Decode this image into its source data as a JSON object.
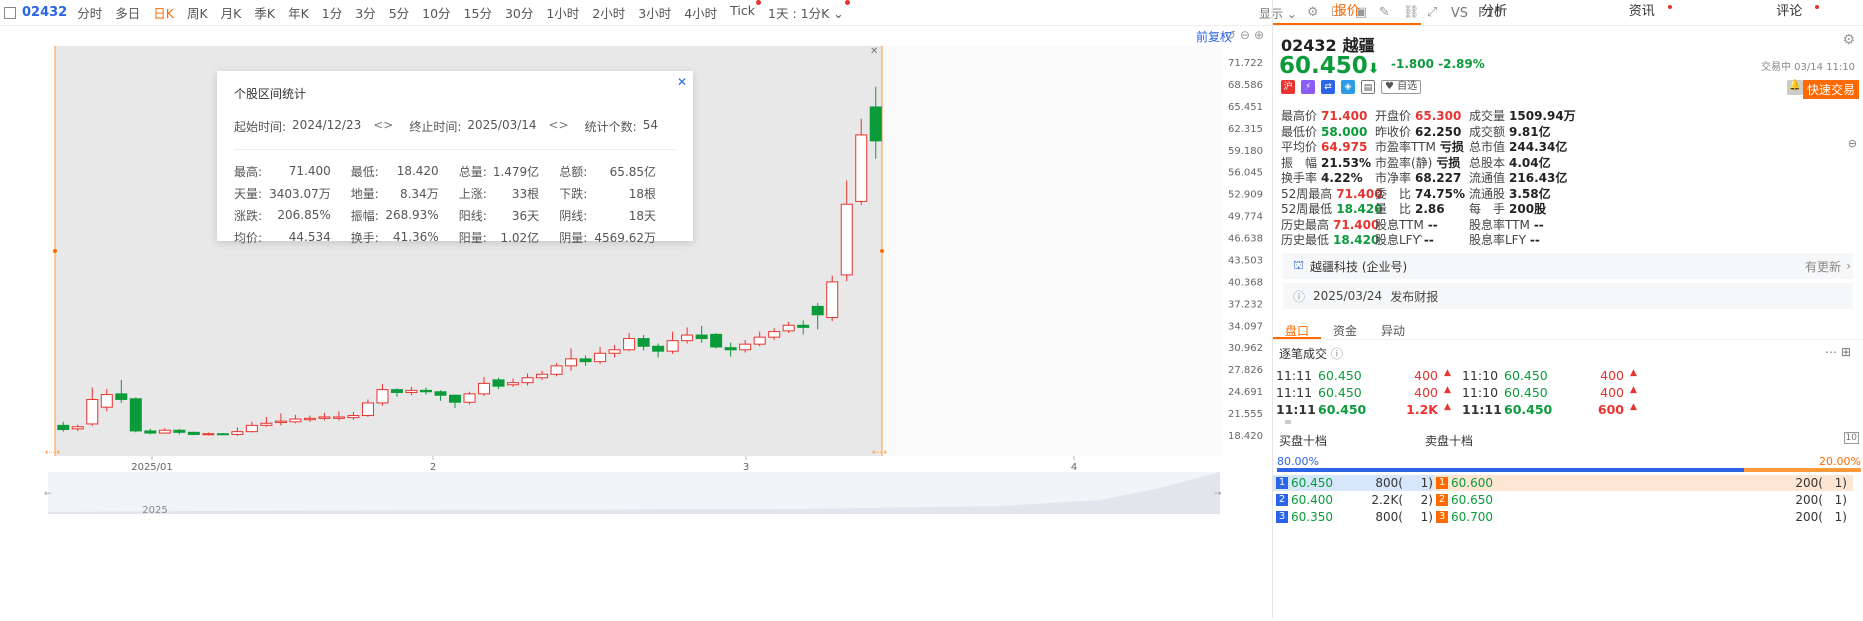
{
  "toolbar": {
    "code": "02432",
    "periods": [
      "分时",
      "多日",
      "日K",
      "周K",
      "月K",
      "季K",
      "年K",
      "1分",
      "3分",
      "5分",
      "10分",
      "15分",
      "30分",
      "1小时",
      "2小时",
      "3小时",
      "4小时",
      "Tick",
      "1天 : 1分K"
    ],
    "active": "日K",
    "display_label": "显示",
    "vs_label": "VS",
    "f10_label": "F10"
  },
  "chart": {
    "adjust_label": "前复权",
    "y_ticks": [
      "71.722",
      "68.586",
      "65.451",
      "62.315",
      "59.180",
      "56.045",
      "52.909",
      "49.774",
      "46.638",
      "43.503",
      "40.368",
      "37.232",
      "34.097",
      "30.962",
      "27.826",
      "24.691",
      "21.555",
      "18.420"
    ],
    "x_labels": [
      "2025/01",
      "2",
      "3",
      "4"
    ],
    "nav_label": "2025"
  },
  "chart_data": {
    "type": "candlestick",
    "x": "trading days 2024/12/23 – 2025/03/14",
    "ylim": [
      18.42,
      71.722
    ],
    "candles": [
      [
        19.8,
        19.2,
        20.3,
        18.9
      ],
      [
        19.3,
        19.6,
        19.9,
        19.0
      ],
      [
        20.0,
        23.5,
        25.2,
        19.7
      ],
      [
        22.4,
        24.2,
        25.0,
        21.8
      ],
      [
        24.3,
        23.5,
        26.3,
        23.0
      ],
      [
        23.6,
        19.0,
        23.8,
        18.8
      ],
      [
        19.0,
        18.7,
        19.3,
        18.5
      ],
      [
        18.7,
        19.1,
        19.4,
        18.6
      ],
      [
        19.1,
        18.8,
        19.3,
        18.5
      ],
      [
        18.8,
        18.5,
        18.9,
        18.4
      ],
      [
        18.5,
        18.6,
        18.8,
        18.4
      ],
      [
        18.6,
        18.5,
        18.7,
        18.4
      ],
      [
        18.5,
        18.9,
        19.5,
        18.3
      ],
      [
        18.9,
        19.8,
        20.3,
        18.8
      ],
      [
        19.8,
        20.1,
        21.0,
        19.6
      ],
      [
        20.2,
        20.4,
        21.5,
        19.8
      ],
      [
        20.3,
        20.7,
        21.3,
        20.1
      ],
      [
        20.6,
        20.8,
        21.2,
        20.3
      ],
      [
        20.8,
        21.0,
        21.6,
        20.5
      ],
      [
        20.8,
        21.0,
        21.8,
        20.5
      ],
      [
        20.9,
        21.2,
        21.7,
        20.6
      ],
      [
        21.2,
        23.0,
        23.5,
        21.0
      ],
      [
        23.0,
        24.9,
        25.7,
        22.6
      ],
      [
        24.9,
        24.5,
        25.1,
        23.9
      ],
      [
        24.5,
        24.8,
        25.3,
        24.1
      ],
      [
        24.8,
        24.6,
        25.2,
        24.2
      ],
      [
        24.6,
        24.1,
        24.8,
        23.3
      ],
      [
        24.1,
        23.1,
        24.2,
        22.3
      ],
      [
        23.1,
        24.3,
        24.6,
        22.8
      ],
      [
        24.3,
        25.8,
        26.7,
        24.0
      ],
      [
        26.3,
        25.4,
        26.6,
        25.0
      ],
      [
        25.6,
        25.9,
        26.5,
        25.3
      ],
      [
        25.9,
        26.6,
        27.2,
        25.5
      ],
      [
        26.6,
        27.1,
        27.6,
        26.3
      ],
      [
        27.1,
        28.3,
        28.7,
        26.8
      ],
      [
        28.3,
        29.3,
        30.8,
        27.6
      ],
      [
        29.3,
        28.9,
        29.8,
        28.3
      ],
      [
        28.9,
        30.1,
        31.0,
        28.6
      ],
      [
        30.1,
        30.6,
        31.3,
        29.5
      ],
      [
        30.6,
        32.2,
        33.0,
        30.4
      ],
      [
        32.2,
        31.1,
        32.7,
        30.5
      ],
      [
        31.1,
        30.4,
        31.5,
        29.5
      ],
      [
        30.4,
        31.9,
        33.2,
        30.0
      ],
      [
        31.9,
        32.7,
        33.8,
        31.5
      ],
      [
        32.7,
        32.2,
        34.0,
        31.6
      ],
      [
        32.8,
        31.0,
        33.0,
        30.8
      ],
      [
        30.9,
        30.6,
        31.6,
        29.6
      ],
      [
        30.6,
        31.4,
        32.0,
        30.2
      ],
      [
        31.4,
        32.4,
        33.2,
        31.1
      ],
      [
        32.4,
        33.2,
        33.7,
        32.0
      ],
      [
        33.3,
        34.1,
        34.6,
        33.0
      ],
      [
        34.1,
        33.8,
        34.8,
        32.8
      ],
      [
        36.8,
        35.6,
        37.3,
        33.5
      ],
      [
        35.2,
        40.3,
        41.2,
        34.7
      ],
      [
        41.3,
        51.4,
        54.8,
        40.4
      ],
      [
        51.8,
        61.3,
        63.6,
        51.3
      ],
      [
        65.3,
        60.45,
        68.2,
        57.9
      ]
    ]
  },
  "modal": {
    "title": "个股区间统计",
    "start_label": "起始时间:",
    "start": "2024/12/23",
    "end_label": "终止时间:",
    "end": "2025/03/14",
    "count_label": "统计个数:",
    "count": "54",
    "rows": [
      [
        [
          "最高:",
          "71.400",
          "red"
        ],
        [
          "最低:",
          "18.420",
          "green"
        ],
        [
          "总量:",
          "1.479亿",
          ""
        ],
        [
          "总额:",
          "65.85亿",
          ""
        ]
      ],
      [
        [
          "天量:",
          "3403.07万",
          ""
        ],
        [
          "地量:",
          "8.34万",
          ""
        ],
        [
          "上涨:",
          "33根",
          "red"
        ],
        [
          "下跌:",
          "18根",
          "green"
        ]
      ],
      [
        [
          "涨跌:",
          "206.85%",
          "red"
        ],
        [
          "振幅:",
          "268.93%",
          ""
        ],
        [
          "阳线:",
          "36天",
          "red"
        ],
        [
          "阴线:",
          "18天",
          "green"
        ]
      ],
      [
        [
          "均价:",
          "44.534",
          "red"
        ],
        [
          "换手:",
          "41.36%",
          ""
        ],
        [
          "阳量:",
          "1.02亿",
          "red"
        ],
        [
          "阴量:",
          "4569.62万",
          "green"
        ]
      ]
    ]
  },
  "panel": {
    "tabs": [
      "报价",
      "分析",
      "资讯",
      "评论"
    ],
    "code": "02432",
    "name": "越疆",
    "price": "60.450",
    "arrow": "⬇",
    "change": "-1.800",
    "change_pct": "-2.89%",
    "trade_status": "交易中 03/14 11:10",
    "fav_label": "自选",
    "quick_trade": "快速交易",
    "quote_grid": [
      [
        "最高价",
        "71.400",
        "red"
      ],
      [
        "开盘价",
        "65.300",
        "red"
      ],
      [
        "成交量",
        "1509.94万",
        "k"
      ],
      [
        "最低价",
        "58.000",
        "green"
      ],
      [
        "昨收价",
        "62.250",
        "k"
      ],
      [
        "成交额",
        "9.81亿",
        "k"
      ],
      [
        "平均价",
        "64.975",
        "red"
      ],
      [
        "市盈率TTM",
        "亏损",
        "k"
      ],
      [
        "总市值",
        "244.34亿",
        "k"
      ],
      [
        "振　幅",
        "21.53%",
        "k"
      ],
      [
        "市盈率(静)",
        "亏损",
        "k"
      ],
      [
        "总股本",
        "4.04亿",
        "k"
      ],
      [
        "换手率",
        "4.22%",
        "k"
      ],
      [
        "市净率",
        "68.227",
        "k"
      ],
      [
        "流通值",
        "216.43亿",
        "k"
      ],
      [
        "52周最高",
        "71.400",
        "red"
      ],
      [
        "委　比",
        "74.75%",
        "k"
      ],
      [
        "流通股",
        "3.58亿",
        "k"
      ],
      [
        "52周最低",
        "18.420",
        "green"
      ],
      [
        "量　比",
        "2.86",
        "k"
      ],
      [
        "每　手",
        "200股",
        "k"
      ],
      [
        "历史最高",
        "71.400",
        "red"
      ],
      [
        "股息TTM",
        "--",
        "k"
      ],
      [
        "股息率TTM",
        "--",
        "k"
      ],
      [
        "历史最低",
        "18.420",
        "green"
      ],
      [
        "股息LFY",
        "--",
        "k"
      ],
      [
        "股息率LFY",
        "--",
        "k"
      ]
    ],
    "org_name": "越疆科技 (企业号)",
    "org_more": "有更新",
    "report_date": "2025/03/24",
    "report_label": "发布财报",
    "subtabs": [
      "盘口",
      "资金",
      "异动"
    ],
    "tick_title": "逐笔成交",
    "ticks": [
      {
        "l": [
          "11:11",
          "60.450",
          "400"
        ],
        "r": [
          "11:10",
          "60.450",
          "400"
        ],
        "bold": false
      },
      {
        "l": [
          "11:11",
          "60.450",
          "400"
        ],
        "r": [
          "11:10",
          "60.450",
          "400"
        ],
        "bold": false
      },
      {
        "l": [
          "11:11",
          "60.450",
          "1.2K"
        ],
        "r": [
          "11:11",
          "60.450",
          "600"
        ],
        "bold": true
      }
    ],
    "buy_title": "买盘十档",
    "sell_title": "卖盘十档",
    "buy_pct": "80.00%",
    "sell_pct": "20.00%",
    "orderbook": [
      {
        "n": "1",
        "bp": "60.450",
        "bq": "800(",
        "bc": "1)",
        "sp": "60.600",
        "sq": "200(",
        "sc": "1)"
      },
      {
        "n": "2",
        "bp": "60.400",
        "bq": "2.2K(",
        "bc": "2)",
        "sp": "60.650",
        "sq": "200(",
        "sc": "1)"
      },
      {
        "n": "3",
        "bp": "60.350",
        "bq": "800(",
        "bc": "1)",
        "sp": "60.700",
        "sq": "200(",
        "sc": "1)"
      }
    ],
    "colors": {
      "up": "#e8332e",
      "down": "#0b9b3b",
      "accent": "#ff6a00",
      "link": "#2b64e6"
    }
  }
}
